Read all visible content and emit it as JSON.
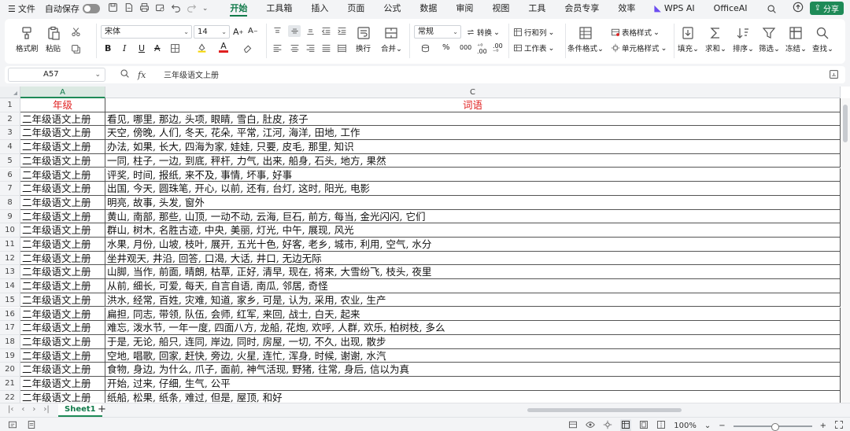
{
  "menubar": {
    "file_label": "文件",
    "autosave_label": "自动保存",
    "tabs": [
      "开始",
      "工具箱",
      "插入",
      "页面",
      "公式",
      "数据",
      "审阅",
      "视图",
      "工具",
      "会员专享",
      "效率"
    ],
    "active_tab": "开始",
    "wps_ai_label": "WPS AI",
    "office_ai_label": "OfficeAI",
    "share_label": "分享"
  },
  "ribbon": {
    "format_painter": "格式刷",
    "paste": "粘贴",
    "font_name": "宋体",
    "font_size": "14",
    "bold": "B",
    "italic": "I",
    "underline": "U",
    "number_format": "常规",
    "convert": "转换",
    "rows_cols": "行和列",
    "worksheet": "工作表",
    "wrap": "换行",
    "merge": "合并",
    "cond_format": "条件格式",
    "table_style": "表格样式",
    "cell_style": "单元格样式",
    "fill": "填充",
    "sum": "求和",
    "sort": "排序",
    "filter": "筛选",
    "freeze": "冻结",
    "find": "查找",
    "percent": "%",
    "thousands": "000"
  },
  "formula_bar": {
    "cell_ref": "A57",
    "fx": "fx",
    "content": "三年级语文上册"
  },
  "sheet": {
    "columns": [
      {
        "letter": "A",
        "selected": true
      },
      {
        "letter": "C",
        "selected": false
      }
    ],
    "header": {
      "num": "1",
      "a": "年级",
      "c": "词语"
    },
    "rows": [
      {
        "num": "2",
        "a": "二年级语文上册",
        "c": "看见, 哪里, 那边, 头项, 眼睛, 雪白, 肚皮, 孩子"
      },
      {
        "num": "3",
        "a": "二年级语文上册",
        "c": "天空, 傍晚, 人们, 冬天, 花朵, 平常, 江河, 海洋, 田地, 工作"
      },
      {
        "num": "4",
        "a": "二年级语文上册",
        "c": "办法, 如果, 长大, 四海为家, 娃娃, 只要, 皮毛, 那里, 知识"
      },
      {
        "num": "5",
        "a": "二年级语文上册",
        "c": "一同, 柱子, 一边, 到底, 秤杆, 力气, 出来, 船身, 石头, 地方, 果然"
      },
      {
        "num": "6",
        "a": "二年级语文上册",
        "c": "评奖, 时间, 报纸, 来不及, 事情, 坏事, 好事"
      },
      {
        "num": "7",
        "a": "二年级语文上册",
        "c": "出国, 今天, 圆珠笔, 开心, 以前, 还有, 台灯, 这时, 阳光, 电影"
      },
      {
        "num": "8",
        "a": "二年级语文上册",
        "c": "明亮, 故事, 头发, 窗外"
      },
      {
        "num": "9",
        "a": "二年级语文上册",
        "c": "黄山, 南部, 那些, 山顶, 一动不动, 云海, 巨石, 前方, 每当, 金光闪闪, 它们"
      },
      {
        "num": "10",
        "a": "二年级语文上册",
        "c": "群山, 树木, 名胜古迹, 中央, 美丽, 灯光, 中午, 展现, 风光"
      },
      {
        "num": "11",
        "a": "二年级语文上册",
        "c": "水果, 月份, 山坡, 枝叶, 展开, 五光十色, 好客, 老乡, 城市, 利用, 空气, 水分"
      },
      {
        "num": "12",
        "a": "二年级语文上册",
        "c": "坐井观天, 井沿, 回答, 口渴, 大话, 井口, 无边无际"
      },
      {
        "num": "13",
        "a": "二年级语文上册",
        "c": "山脚, 当作, 前面, 晴朗, 枯草, 正好, 清早, 现在, 将来, 大雪纷飞, 枝头, 夜里"
      },
      {
        "num": "14",
        "a": "二年级语文上册",
        "c": "从前, 细长, 可爱, 每天, 自言自语, 南瓜, 邻居, 奇怪"
      },
      {
        "num": "15",
        "a": "二年级语文上册",
        "c": "洪水, 经常, 百姓, 灾难, 知道, 家乡, 可是, 认为, 采用, 农业, 生产"
      },
      {
        "num": "16",
        "a": "二年级语文上册",
        "c": "扁担, 同志, 带领, 队伍, 会师, 红军, 来回, 战士, 白天, 起来"
      },
      {
        "num": "17",
        "a": "二年级语文上册",
        "c": "难忘, 泼水节, 一年一度, 四面八方, 龙船, 花炮, 欢呼, 人群, 欢乐, 柏树枝, 多么"
      },
      {
        "num": "18",
        "a": "二年级语文上册",
        "c": "于是, 无论, 船只, 连同, 岸边, 同时, 房屋, 一切, 不久, 出现, 散步"
      },
      {
        "num": "19",
        "a": "二年级语文上册",
        "c": "空地, 唱歌, 回家, 赶快, 旁边, 火星, 连忙, 浑身, 时候, 谢谢, 水汽"
      },
      {
        "num": "20",
        "a": "二年级语文上册",
        "c": "食物, 身边, 为什么, 爪子, 面前, 神气活现, 野猪, 往常, 身后, 信以为真"
      },
      {
        "num": "21",
        "a": "二年级语文上册",
        "c": "开始, 过来, 仔细, 生气, 公平"
      },
      {
        "num": "22",
        "a": "二年级语文上册",
        "c": "纸船, 松果, 纸条, 难过, 但是, 屋顶, 和好"
      }
    ]
  },
  "sheet_tabs": {
    "active": "Sheet1",
    "add": "+"
  },
  "statusbar": {
    "zoom": "100%"
  },
  "colors": {
    "accent": "#1e8a57",
    "header_text": "#e02020"
  }
}
